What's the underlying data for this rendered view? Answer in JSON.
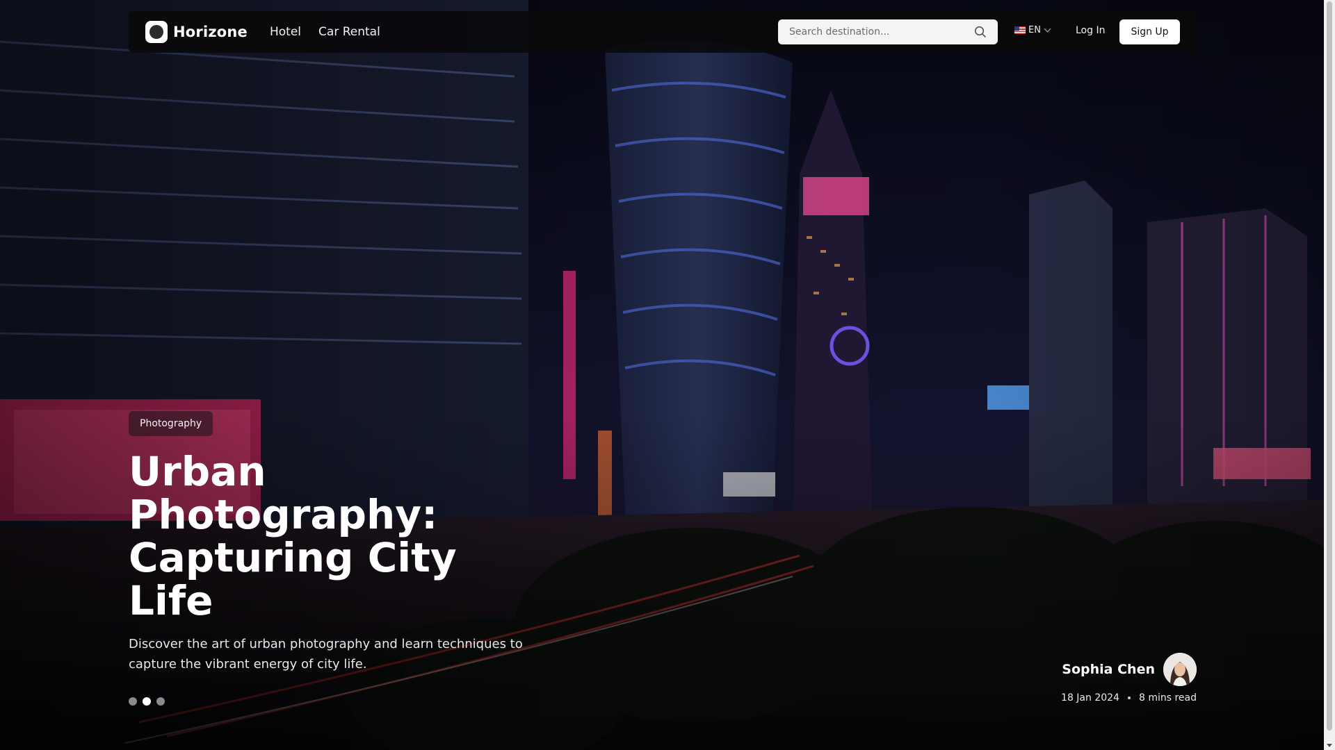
{
  "nav": {
    "brand": "Horizone",
    "links": [
      "Hotel",
      "Car Rental"
    ],
    "search_placeholder": "Search destination...",
    "language": "EN",
    "login": "Log In",
    "signup": "Sign Up"
  },
  "hero": {
    "category": "Photography",
    "title": "Urban Photography: Capturing City Life",
    "excerpt": "Discover the art of urban photography and learn techniques to capture the vibrant energy of city life.",
    "slides": 3,
    "active_slide": 2,
    "author": "Sophia Chen",
    "date": "18 Jan 2024",
    "read_time": "8 mins read"
  },
  "colors": {
    "accent_pink": "#ff2e8a",
    "accent_blue": "#3a6bff",
    "button_bg": "#ffffff"
  },
  "icons": {
    "search": "search-icon",
    "language": "flag-us-icon",
    "dropdown": "chevron-down-icon"
  }
}
